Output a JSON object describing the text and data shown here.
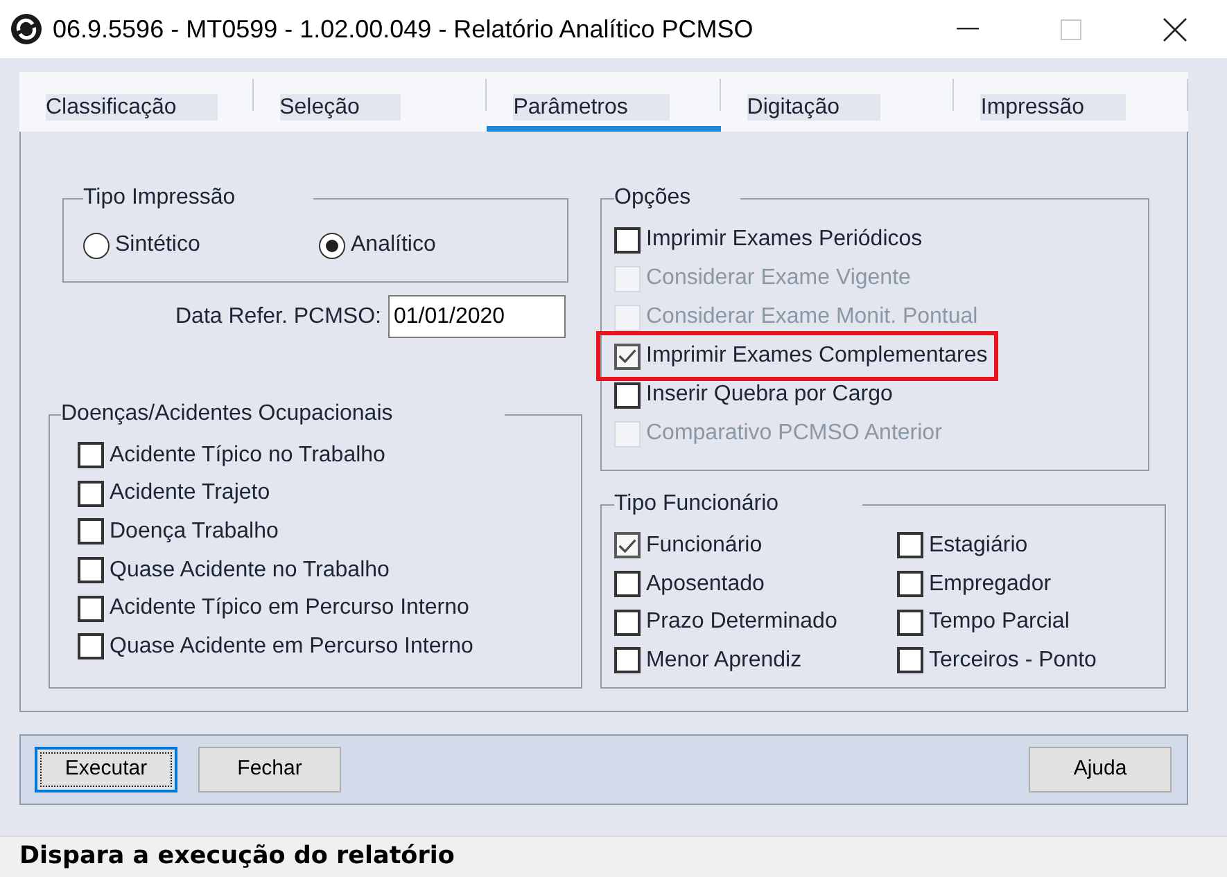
{
  "window": {
    "title": "06.9.5596 - MT0599 - 1.02.00.049 - Relatório Analítico PCMSO",
    "maximize_disabled": true
  },
  "tabs": [
    {
      "label": "Classificação",
      "selected": false
    },
    {
      "label": "Seleção",
      "selected": false
    },
    {
      "label": "Parâmetros",
      "selected": true
    },
    {
      "label": "Digitação",
      "selected": false
    },
    {
      "label": "Impressão",
      "selected": false
    }
  ],
  "print_type": {
    "legend": "Tipo Impressão",
    "options": [
      {
        "label": "Sintético",
        "selected": false
      },
      {
        "label": "Analítico",
        "selected": true
      }
    ]
  },
  "reference_date": {
    "label": "Data Refer. PCMSO:",
    "value": "01/01/2020"
  },
  "occupational_events": {
    "legend": "Doenças/Acidentes Ocupacionais",
    "items": [
      {
        "label": "Acidente Típico no Trabalho",
        "checked": false
      },
      {
        "label": "Acidente Trajeto",
        "checked": false
      },
      {
        "label": "Doença Trabalho",
        "checked": false
      },
      {
        "label": "Quase Acidente no Trabalho",
        "checked": false
      },
      {
        "label": "Acidente Típico em Percurso Interno",
        "checked": false
      },
      {
        "label": "Quase Acidente em Percurso Interno",
        "checked": false
      }
    ]
  },
  "options": {
    "legend": "Opções",
    "items": [
      {
        "label": "Imprimir Exames Periódicos",
        "checked": false,
        "disabled": false,
        "highlighted": false
      },
      {
        "label": "Considerar Exame Vigente",
        "checked": false,
        "disabled": true,
        "highlighted": false
      },
      {
        "label": "Considerar Exame Monit. Pontual",
        "checked": false,
        "disabled": true,
        "highlighted": false
      },
      {
        "label": "Imprimir Exames Complementares",
        "checked": true,
        "disabled": false,
        "highlighted": true
      },
      {
        "label": "Inserir Quebra por Cargo",
        "checked": false,
        "disabled": false,
        "highlighted": false
      },
      {
        "label": "Comparativo PCMSO Anterior",
        "checked": false,
        "disabled": true,
        "highlighted": false
      }
    ]
  },
  "employee_type": {
    "legend": "Tipo Funcionário",
    "items": [
      {
        "label": "Funcionário",
        "checked": true
      },
      {
        "label": "Estagiário",
        "checked": false
      },
      {
        "label": "Aposentado",
        "checked": false
      },
      {
        "label": "Empregador",
        "checked": false
      },
      {
        "label": "Prazo Determinado",
        "checked": false
      },
      {
        "label": "Tempo Parcial",
        "checked": false
      },
      {
        "label": "Menor Aprendiz",
        "checked": false
      },
      {
        "label": "Terceiros - Ponto",
        "checked": false
      }
    ]
  },
  "buttons_left": [
    {
      "label": "Executar",
      "focused": true
    },
    {
      "label": "Fechar",
      "focused": false
    }
  ],
  "buttons_right": [
    {
      "label": "Ajuda",
      "focused": false
    }
  ],
  "status_bar": {
    "text": "Dispara a execução do relatório"
  }
}
